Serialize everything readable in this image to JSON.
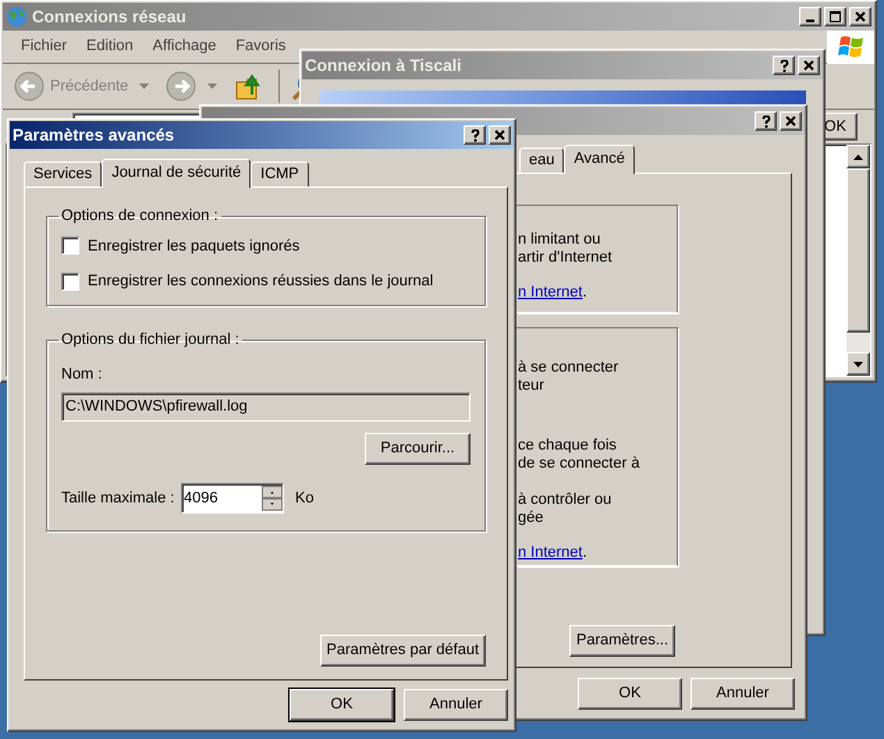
{
  "explorer_window": {
    "title": "Connexions réseau",
    "active": false,
    "menu": [
      "Fichier",
      "Edition",
      "Affichage",
      "Favoris"
    ],
    "back_button": "Précédente",
    "go_button": "OK"
  },
  "connection_window": {
    "title": "Connexion à Tiscali",
    "active": false
  },
  "properties_window": {
    "active": false,
    "tabs": [
      {
        "label": "eau",
        "selected": false
      },
      {
        "label": "Avancé",
        "selected": true
      }
    ],
    "groups": [
      {
        "paragraphs": [
          [
            "n limitant ou",
            "artir d'Internet"
          ]
        ],
        "link": "n Internet",
        "link_suffix": "."
      },
      {
        "paragraphs": [
          [
            "à se connecter",
            "teur"
          ],
          [
            "ce chaque fois",
            "de se connecter à"
          ],
          [
            "à contrôler ou",
            "gée"
          ]
        ],
        "link": "n Internet",
        "link_suffix": "."
      }
    ],
    "settings_button": "Paramètres...",
    "ok_button": "OK",
    "cancel_button": "Annuler"
  },
  "advanced_window": {
    "title": "Paramètres avancés",
    "active": true,
    "tabs": [
      {
        "label": "Services",
        "selected": false
      },
      {
        "label": "Journal de sécurité",
        "selected": true
      },
      {
        "label": "ICMP",
        "selected": false
      }
    ],
    "connection_options": {
      "title": "Options de connexion :",
      "options": [
        {
          "label": "Enregistrer les paquets ignorés",
          "checked": false
        },
        {
          "label": "Enregistrer les connexions réussies dans le journal",
          "checked": false
        }
      ]
    },
    "log_options": {
      "title": "Options du fichier journal :",
      "name_label": "Nom :",
      "name_value": "C:\\WINDOWS\\pfirewall.log",
      "browse_button": "Parcourir...",
      "size_label": "Taille maximale :",
      "size_value": "4096",
      "size_unit": "Ko"
    },
    "defaults_button": "Paramètres par défaut",
    "ok_button": "OK",
    "cancel_button": "Annuler"
  }
}
